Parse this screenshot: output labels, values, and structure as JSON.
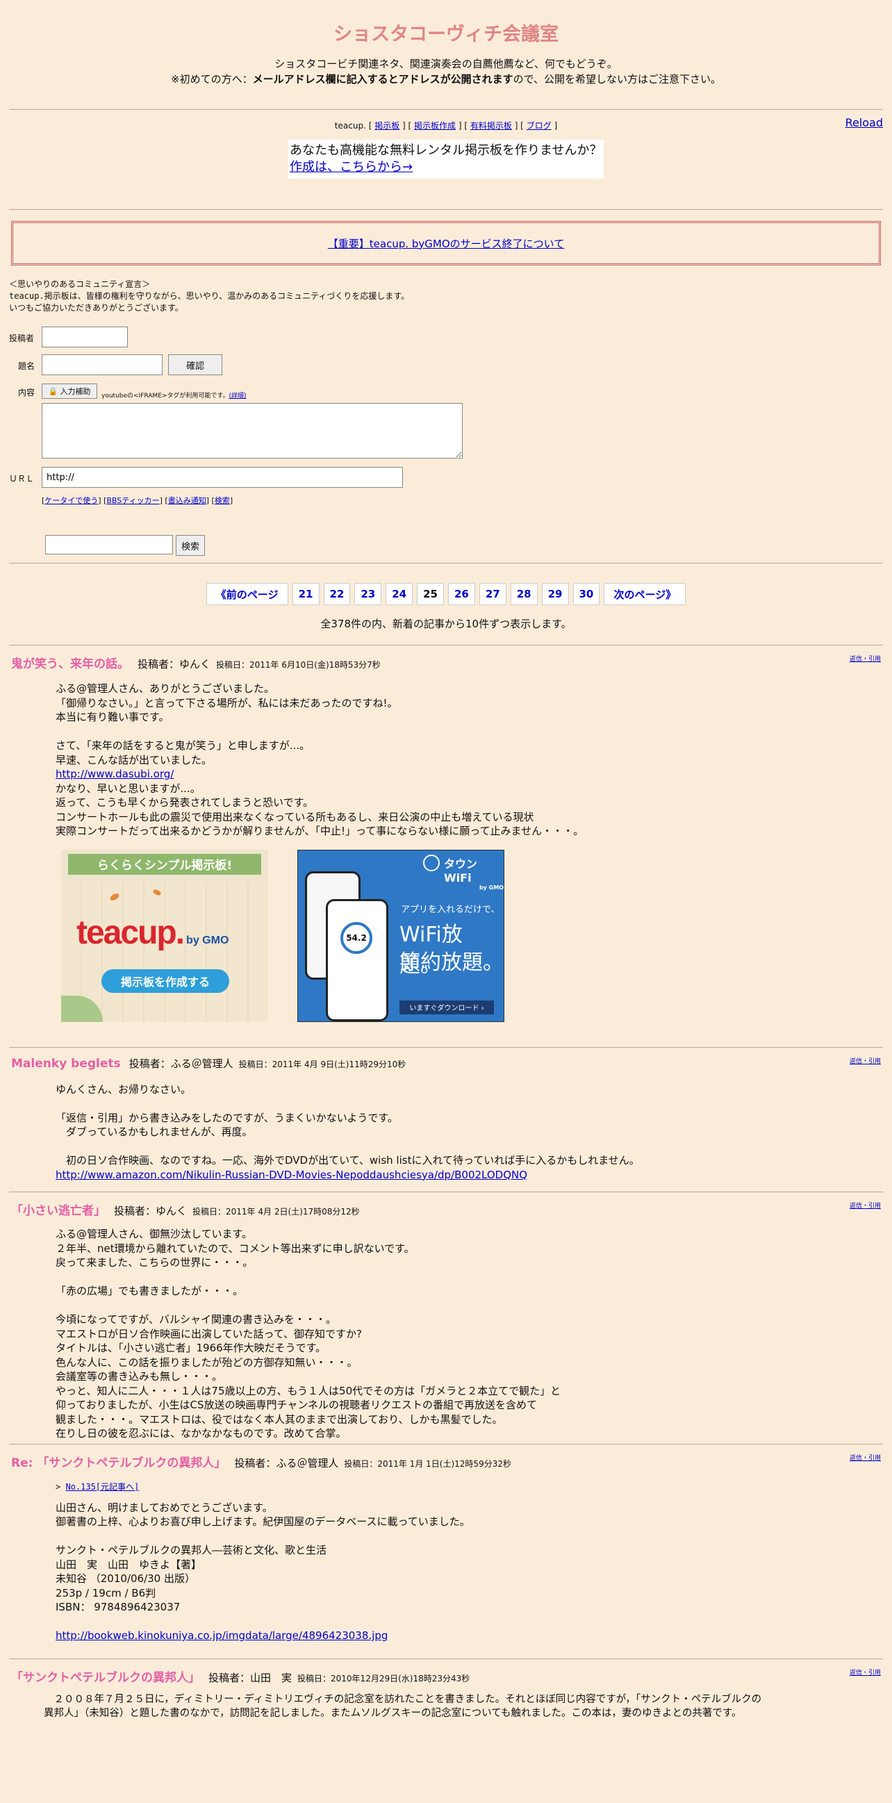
{
  "header": {
    "title": "ショスタコーヴィチ会議室",
    "intro_line1": "ショスタコービチ関連ネタ、関連演奏会の自薦他薦など、何でもどうぞ。",
    "intro_line2_a": "※初めての方へ：",
    "intro_line2_bold": "メールアドレス欄に記入するとアドレスが公開されます",
    "intro_line2_b": "ので、公開を希望しない方はご注意下さい。",
    "reload": "Reload"
  },
  "teacup_nav": {
    "prefix": "teacup. [",
    "items": [
      "掲示板",
      "掲示板作成",
      "有料掲示板",
      "ブログ"
    ]
  },
  "ad_box": {
    "line1": "あなたも高機能な無料レンタル掲示板を作りませんか？",
    "link": "作成は、こちらから→"
  },
  "notice": "【重要】teacup. byGMOのサービス終了について",
  "declaration": {
    "line1": "＜思いやりのあるコミュニティ宣言＞",
    "line2_mono": "teacup.",
    "line2": "掲示板は、皆様の権利を守りながら、思いやり、温かみのあるコミュニティづくりを応援します。",
    "line3": "いつもご協力いただきありがとうございます。"
  },
  "form": {
    "author_label": "投稿者",
    "subject_label": "題名",
    "confirm": "確認",
    "content_label": "内容",
    "input_assist": "入力補助",
    "iframe_note": "youtubeの<IFRAME>タグが利用可能です。",
    "detail_link": "(詳細)",
    "url_label": "ＵＲＬ",
    "url_value": "http://",
    "links": [
      "ケータイで使う",
      "BBSティッカー",
      "書込み通知",
      "検索"
    ],
    "search_button": "検索"
  },
  "pager": {
    "prev": "《前のページ",
    "pages": [
      "21",
      "22",
      "23",
      "24",
      "25",
      "26",
      "27",
      "28",
      "29",
      "30"
    ],
    "current": "25",
    "next": "次のページ》",
    "summary": "全378件の内、新着の記事から10件ずつ表示します。"
  },
  "posts": [
    {
      "title": "鬼が笑う、来年の話。",
      "author": "投稿者：ゆんく",
      "date": "投稿日：2011年 6月10日(金)18時53分7秒",
      "reply": "返信・引用",
      "body1": "ふる@管理人さん、ありがとうございました。\n「御帰りなさい。」と言って下さる場所が、私には未だあったのですね!。\n本当に有り難い事です。\n\nさて、「来年の話をすると鬼が笑う」と申しますが...。\n早速、こんな話が出ていました。\n",
      "link": "http://www.dasubi.org/",
      "body2": "\nかなり、早いと思いますが...。\n返って、こうも早くから発表されてしまうと恐いです。\nコンサートホールも此の震災で使用出来なくなっている所もあるし、来日公演の中止も増えている現状\n実際コンサートだって出来るかどうかが解りませんが、「中止!」って事にならない様に願って止みません・・・。"
    },
    {
      "title": "Malenky beglets",
      "author": "投稿者：ふる＠管理人",
      "date": "投稿日：2011年 4月 9日(土)11時29分10秒",
      "reply": "返信・引用",
      "body1": "ゆんくさん、お帰りなさい。\n\n「返信・引用」から書き込みをしたのですが、うまくいかないようです。\n　ダブっているかもしれませんが、再度。\n\n　初の日ソ合作映画、なのですね。一応、海外でDVDが出ていて、wish listに入れて待っていれば手に入るかもしれません。\n",
      "link": "http://www.amazon.com/Nikulin-Russian-DVD-Movies-Nepoddaushciesya/dp/B002LODQNQ",
      "body2": ""
    },
    {
      "title": "「小さい逃亡者」",
      "author": "投稿者：ゆんく",
      "date": "投稿日：2011年 4月 2日(土)17時08分12秒",
      "reply": "返信・引用",
      "body1": "ふる@管理人さん、御無沙汰しています。\n２年半、net環境から離れていたので、コメント等出来ずに申し訳ないです。\n戻って来ました、こちらの世界に・・・。\n\n「赤の広場」でも書きましたが・・・。\n\n今頃になってですが、バルシャイ関連の書き込みを・・・。\nマエストロが日ソ合作映画に出演していた話って、御存知ですか?\nタイトルは、「小さい逃亡者」1966年作大映だそうです。\n色んな人に、この話を振りましたが殆どの方御存知無い・・・。\n会議室等の書き込みも無し・・・。\nやっと、知人に二人・・・１人は75歳以上の方、もう１人は50代でその方は「ガメラと２本立てで観た」と\n仰っておりましたが、小生はCS放送の映画専門チャンネルの視聴者リクエストの番組で再放送を含めて\n観ました・・・。マエストロは、役ではなく本人其のままで出演しており、しかも黒髪でした。\n在りし日の彼を忍ぶには、なかなかなものです。改めて合掌。",
      "link": "",
      "body2": ""
    },
    {
      "title": "Re: 「サンクトペテルブルクの異邦人」",
      "author": "投稿者：ふる＠管理人",
      "date": "投稿日：2011年 1月 1日(土)12時59分32秒",
      "reply": "返信・引用",
      "quote": "No.135[元記事へ]",
      "body1": "山田さん、明けましておめでとうございます。\n御著書の上梓、心よりお喜び申し上げます。紀伊国屋のデータベースに載っていました。\n\nサンクト・ペテルブルクの異邦人―芸術と文化、歌と生活\n山田　実　山田　ゆきよ【著】\n未知谷 （2010/06/30 出版）\n253p / 19cm / B6判\nISBN： 9784896423037\n\n",
      "link": "http://bookweb.kinokuniya.co.jp/imgdata/large/4896423038.jpg",
      "body2": ""
    },
    {
      "title": "「サンクトペテルブルクの異邦人」",
      "author": "投稿者：山田　実",
      "date": "投稿日：2010年12月29日(水)18時23分43秒",
      "reply": "返信・引用",
      "body1": "　２００８年７月２５日に，ディミトリー・ディミトリエヴィチの記念室を訪れたことを書きました。それとほぼ同じ内容ですが，「サンクト・ペテルブルクの\n異邦人」（未知谷）と題した書のなかで，訪問記を記しました。またムソルグスキーの記念室についても触れました。この本は，妻のゆきよとの共著です。",
      "link": "",
      "body2": ""
    }
  ],
  "banners": {
    "left_top": "らくらくシンプル掲示板!",
    "left_logo": "teacup.",
    "left_by": "by GMO",
    "left_button": "掲示板を作成する",
    "right_brand": "タウンWiFi",
    "right_by": "by GMO",
    "right_line1": "アプリを入れるだけで、",
    "right_line2": "WiFi放題。",
    "right_line3": "節約放題。",
    "right_button": "いますぐダウンロード ›",
    "phone_value": "54.2"
  },
  "colors": {
    "background": "#fbecd9",
    "title": "#e08585",
    "post_title": "#e55fa6",
    "link": "#0000cc"
  }
}
